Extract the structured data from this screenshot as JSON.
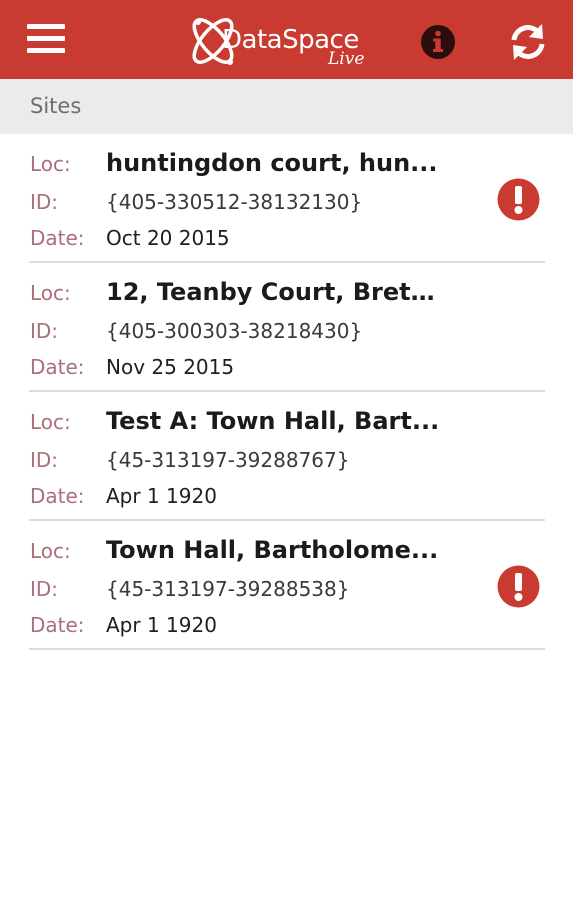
{
  "app": {
    "brand_name": "DataSpace",
    "brand_tagline": "Live",
    "colors": {
      "primary": "#c93a31",
      "header_bg": "#ebebeb",
      "label": "#a9707a",
      "alert": "#c93a31"
    }
  },
  "topbar": {
    "menu_icon": "hamburger-menu-icon",
    "info_icon": "info-icon",
    "refresh_icon": "refresh-icon"
  },
  "section": {
    "title": "Sites"
  },
  "labels": {
    "loc": "Loc:",
    "id": "ID:",
    "date": "Date:"
  },
  "sites": [
    {
      "loc": "huntingdon court, hun...",
      "id": "{405-330512-38132130}",
      "date": "Oct 20 2015",
      "alert": true
    },
    {
      "loc": "12, Teanby Court, Brett...",
      "id": "{405-300303-38218430}",
      "date": "Nov 25 2015",
      "alert": false
    },
    {
      "loc": "Test A: Town Hall, Bart...",
      "id": "{45-313197-39288767}",
      "date": "Apr 1 1920",
      "alert": false
    },
    {
      "loc": "Town Hall, Bartholome...",
      "id": "{45-313197-39288538}",
      "date": "Apr 1 1920",
      "alert": true
    }
  ]
}
